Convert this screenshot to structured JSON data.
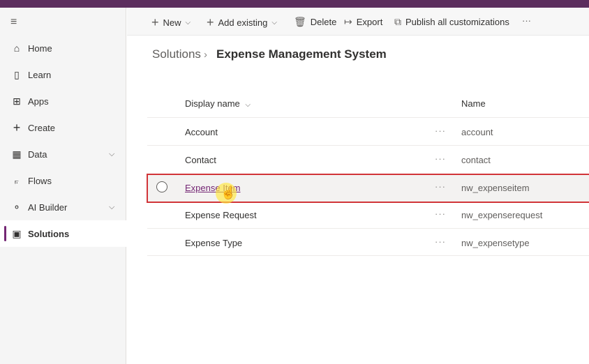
{
  "sidebar": {
    "items": [
      {
        "label": "Home",
        "icon": "home-icon",
        "glyph": "⌂"
      },
      {
        "label": "Learn",
        "icon": "book-icon",
        "glyph": "▯"
      },
      {
        "label": "Apps",
        "icon": "apps-icon",
        "glyph": "⊞"
      },
      {
        "label": "Create",
        "icon": "plus-icon",
        "glyph": "+"
      },
      {
        "label": "Data",
        "icon": "table-icon",
        "glyph": "▦",
        "chevron": "⌵"
      },
      {
        "label": "Flows",
        "icon": "flow-icon",
        "glyph": "⟔"
      },
      {
        "label": "AI Builder",
        "icon": "ai-builder-icon",
        "glyph": "⚬",
        "chevron": "⌵"
      },
      {
        "label": "Solutions",
        "icon": "solutions-icon",
        "glyph": "▣",
        "active": true
      }
    ]
  },
  "commandbar": {
    "new": "New",
    "add_existing": "Add existing",
    "delete": "Delete",
    "export": "Export",
    "publish": "Publish all customizations",
    "more": "···"
  },
  "breadcrumb": {
    "parent": "Solutions",
    "separator": "›",
    "current": "Expense Management System"
  },
  "table": {
    "headers": {
      "display_name": "Display name",
      "name": "Name"
    },
    "rows": [
      {
        "display": "Account",
        "name": "account"
      },
      {
        "display": "Contact",
        "name": "contact"
      },
      {
        "display": "Expense Item",
        "name": "nw_expenseitem",
        "selected": true
      },
      {
        "display": "Expense Request",
        "name": "nw_expenserequest"
      },
      {
        "display": "Expense Type",
        "name": "nw_expensetype"
      }
    ],
    "row_more": "···"
  },
  "colors": {
    "accent": "#742774",
    "topbar": "#5c2e5e",
    "highlight_border": "#d13438"
  }
}
